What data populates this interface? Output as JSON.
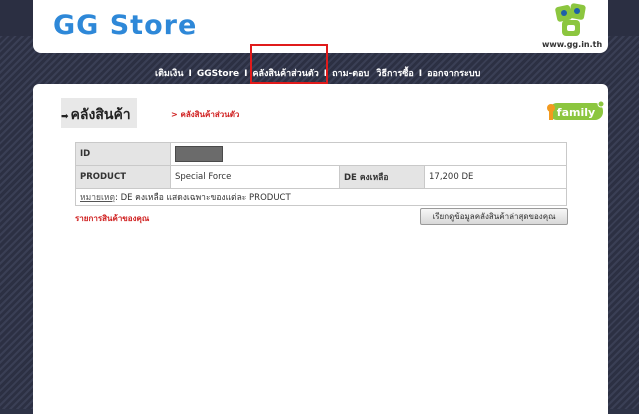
{
  "header": {
    "brand": "GG Store",
    "logo_text": "gg",
    "site_url": "www.gg.in.th"
  },
  "nav": {
    "items": [
      "เติมเงิน",
      "GGStore",
      "คลังสินค้าส่วนตัว",
      "ถาม-ตอบ",
      "วิธีการซื้อ",
      "ออกจากระบบ"
    ],
    "separator": "I",
    "active_index": 2
  },
  "page": {
    "title": "คลังสินค้า",
    "breadcrumb": "> คลังสินค้าส่วนตัว",
    "family_logo": "family"
  },
  "table": {
    "id_label": "ID",
    "product_label": "PRODUCT",
    "product_value": "Special Force",
    "de_label": "DE คงเหลือ",
    "de_value": "17,200 DE",
    "note_label": "หมายเหตุ",
    "note_text": ": DE คงเหลือ   แสดงเฉพาะของแต่ละ   PRODUCT"
  },
  "footer": {
    "inventory_link": "รายการสินค้าของคุณ",
    "fetch_button": "เรียกดูข้อมูลคลังสินค้าล่าสุดของคุณ"
  },
  "colors": {
    "brand_blue": "#2e88d8",
    "accent_red": "#d02020",
    "logo_green": "#8cc63f"
  }
}
